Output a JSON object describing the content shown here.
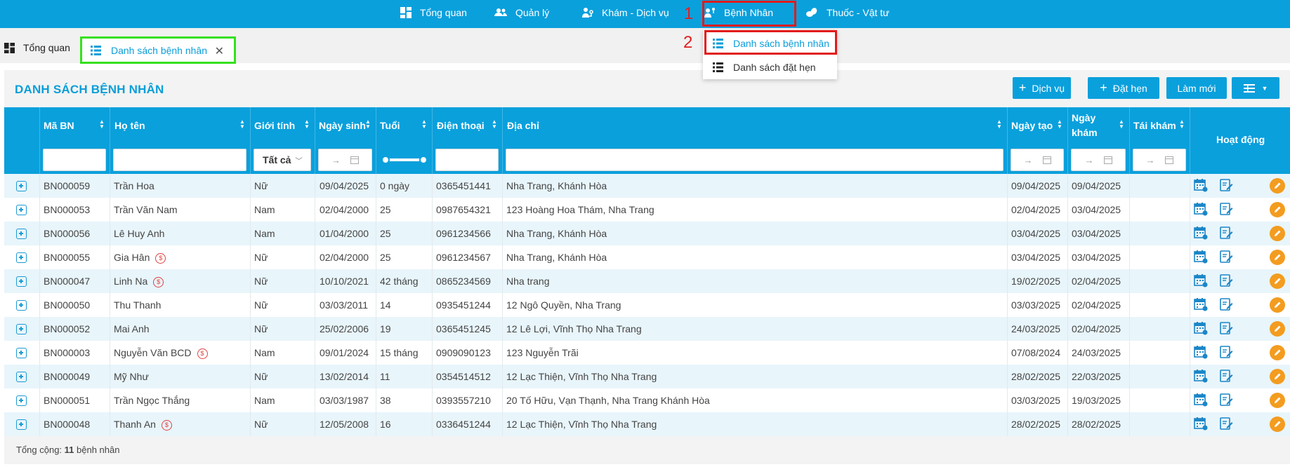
{
  "nav": {
    "items": [
      {
        "label": "Tổng quan",
        "icon": "dashboard-icon"
      },
      {
        "label": "Quản lý",
        "icon": "users-icon"
      },
      {
        "label": "Khám - Dịch vụ",
        "icon": "stethoscope-icon"
      },
      {
        "label": "Bệnh Nhân",
        "icon": "patient-icon"
      },
      {
        "label": "Thuốc - Vật tư",
        "icon": "pills-icon"
      }
    ]
  },
  "annotations": {
    "step1": "1",
    "step2": "2"
  },
  "dropdown": {
    "items": [
      {
        "label": "Danh sách bệnh nhân"
      },
      {
        "label": "Danh sách đặt hẹn"
      }
    ]
  },
  "tabs": {
    "home": "Tổng quan",
    "active": "Danh sách bệnh nhân"
  },
  "page": {
    "title": "DANH SÁCH BỆNH NHÂN",
    "buttons": {
      "service": "Dịch vụ",
      "appointment": "Đặt hẹn",
      "refresh": "Làm mới"
    }
  },
  "table": {
    "headers": {
      "id": "Mã BN",
      "name": "Họ tên",
      "gender": "Giới tính",
      "dob": "Ngày sinh",
      "age": "Tuổi",
      "phone": "Điện thoại",
      "address": "Địa chỉ",
      "created": "Ngày tạo",
      "visit_line1": "Ngày",
      "visit_line2": "khám",
      "revisit": "Tái khám",
      "actions": "Hoạt động"
    },
    "filters": {
      "gender_value": "Tất cả",
      "date_arrow": "→"
    },
    "rows": [
      {
        "id": "BN000059",
        "name": "Trần Hoa",
        "badge": false,
        "gender": "Nữ",
        "dob": "09/04/2025",
        "age": "0 ngày",
        "phone": "0365451441",
        "address": "Nha Trang, Khánh Hòa",
        "created": "09/04/2025",
        "visit": "09/04/2025"
      },
      {
        "id": "BN000053",
        "name": "Trần Văn Nam",
        "badge": false,
        "gender": "Nam",
        "dob": "02/04/2000",
        "age": "25",
        "phone": "0987654321",
        "address": "123 Hoàng Hoa Thám, Nha Trang",
        "created": "02/04/2025",
        "visit": "03/04/2025"
      },
      {
        "id": "BN000056",
        "name": "Lê Huy Anh",
        "badge": false,
        "gender": "Nam",
        "dob": "01/04/2000",
        "age": "25",
        "phone": "0961234566",
        "address": "Nha Trang, Khánh Hòa",
        "created": "03/04/2025",
        "visit": "03/04/2025"
      },
      {
        "id": "BN000055",
        "name": "Gia Hân",
        "badge": true,
        "gender": "Nữ",
        "dob": "02/04/2000",
        "age": "25",
        "phone": "0961234567",
        "address": "Nha Trang, Khánh Hòa",
        "created": "03/04/2025",
        "visit": "03/04/2025"
      },
      {
        "id": "BN000047",
        "name": "Linh Na",
        "badge": true,
        "gender": "Nữ",
        "dob": "10/10/2021",
        "age": "42 tháng",
        "phone": "0865234569",
        "address": "Nha trang",
        "created": "19/02/2025",
        "visit": "02/04/2025"
      },
      {
        "id": "BN000050",
        "name": "Thu Thanh",
        "badge": false,
        "gender": "Nữ",
        "dob": "03/03/2011",
        "age": "14",
        "phone": "0935451244",
        "address": "12 Ngô Quyền, Nha Trang",
        "created": "03/03/2025",
        "visit": "02/04/2025"
      },
      {
        "id": "BN000052",
        "name": "Mai Anh",
        "badge": false,
        "gender": "Nữ",
        "dob": "25/02/2006",
        "age": "19",
        "phone": "0365451245",
        "address": "12 Lê Lợi, Vĩnh Thọ Nha Trang",
        "created": "24/03/2025",
        "visit": "02/04/2025"
      },
      {
        "id": "BN000003",
        "name": "Nguyễn Văn BCD",
        "badge": true,
        "gender": "Nam",
        "dob": "09/01/2024",
        "age": "15 tháng",
        "phone": "0909090123",
        "address": "123 Nguyễn Trãi",
        "created": "07/08/2024",
        "visit": "24/03/2025"
      },
      {
        "id": "BN000049",
        "name": "Mỹ Như",
        "badge": false,
        "gender": "Nữ",
        "dob": "13/02/2014",
        "age": "11",
        "phone": "0354514512",
        "address": "12 Lạc Thiện, Vĩnh Thọ Nha Trang",
        "created": "28/02/2025",
        "visit": "22/03/2025"
      },
      {
        "id": "BN000051",
        "name": "Trần Ngọc Thắng",
        "badge": false,
        "gender": "Nam",
        "dob": "03/03/1987",
        "age": "38",
        "phone": "0393557210",
        "address": "20 Tố Hữu, Vạn Thạnh, Nha Trang Khánh Hòa",
        "created": "03/03/2025",
        "visit": "19/03/2025"
      },
      {
        "id": "BN000048",
        "name": "Thanh An",
        "badge": true,
        "gender": "Nữ",
        "dob": "12/05/2008",
        "age": "16",
        "phone": "0336451244",
        "address": "12 Lạc Thiện, Vĩnh Thọ Nha Trang",
        "created": "28/02/2025",
        "visit": "28/02/2025"
      }
    ],
    "badge_symbol": "$"
  },
  "footer": {
    "prefix": "Tổng cộng: ",
    "count": "11",
    "suffix": " bệnh nhân"
  },
  "colors": {
    "primary": "#0aa0dc",
    "highlight_red": "#e21b1b",
    "highlight_green": "#35e01f",
    "row_alt": "#e8f5fb",
    "action_orange": "#f39c1f"
  }
}
